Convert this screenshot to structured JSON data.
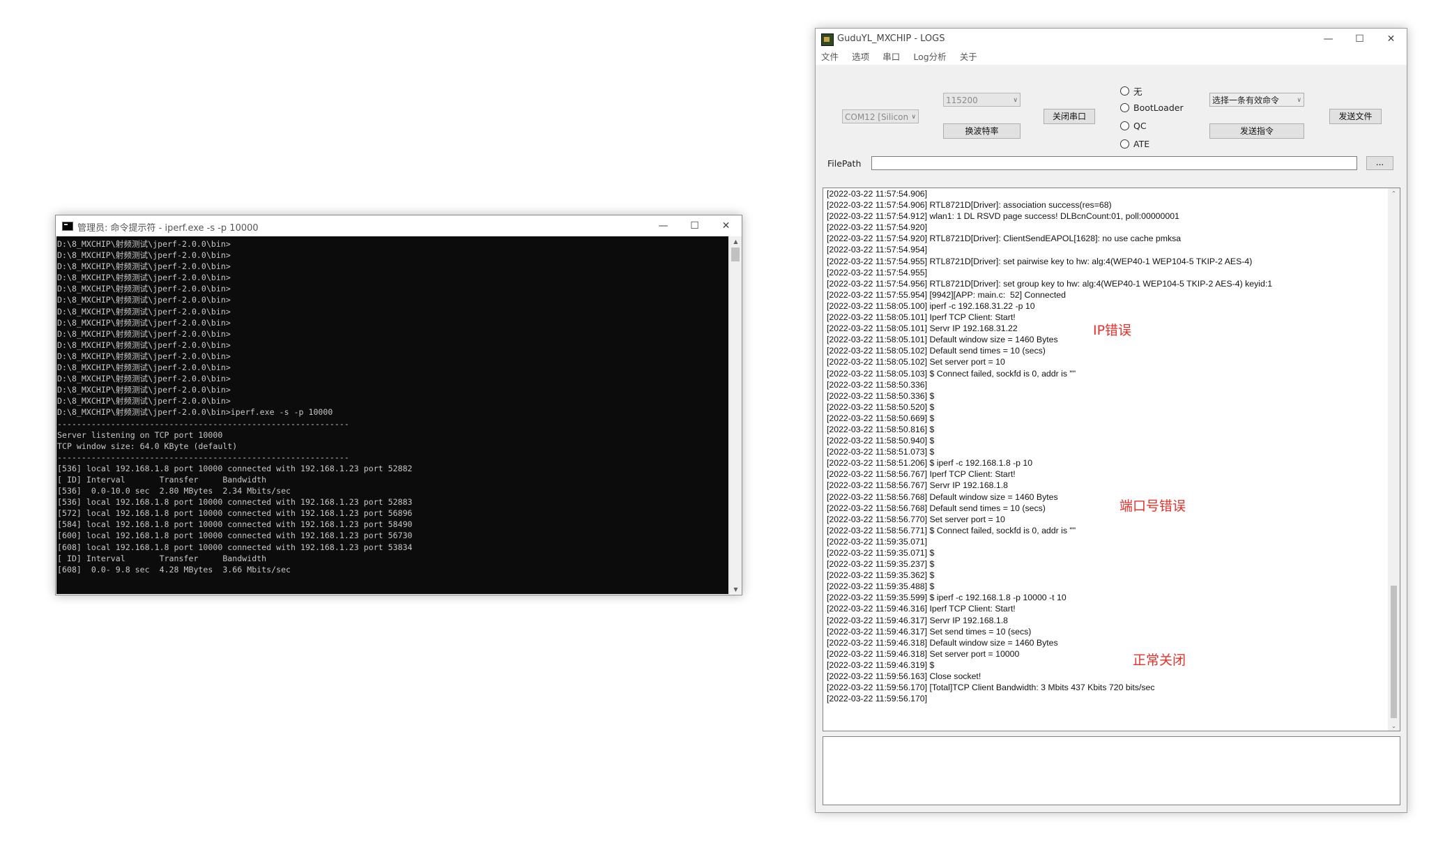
{
  "cmd_window": {
    "title": "管理员: 命令提示符 - iperf.exe  -s -p 10000",
    "console_lines": [
      "D:\\8_MXCHIP\\射频测试\\jperf-2.0.0\\bin>",
      "D:\\8_MXCHIP\\射频测试\\jperf-2.0.0\\bin>",
      "D:\\8_MXCHIP\\射频测试\\jperf-2.0.0\\bin>",
      "D:\\8_MXCHIP\\射频测试\\jperf-2.0.0\\bin>",
      "D:\\8_MXCHIP\\射频测试\\jperf-2.0.0\\bin>",
      "D:\\8_MXCHIP\\射频测试\\jperf-2.0.0\\bin>",
      "D:\\8_MXCHIP\\射频测试\\jperf-2.0.0\\bin>",
      "D:\\8_MXCHIP\\射频测试\\jperf-2.0.0\\bin>",
      "D:\\8_MXCHIP\\射频测试\\jperf-2.0.0\\bin>",
      "D:\\8_MXCHIP\\射频测试\\jperf-2.0.0\\bin>",
      "D:\\8_MXCHIP\\射频测试\\jperf-2.0.0\\bin>",
      "D:\\8_MXCHIP\\射频测试\\jperf-2.0.0\\bin>",
      "D:\\8_MXCHIP\\射频测试\\jperf-2.0.0\\bin>",
      "D:\\8_MXCHIP\\射频测试\\jperf-2.0.0\\bin>",
      "D:\\8_MXCHIP\\射频测试\\jperf-2.0.0\\bin>",
      "D:\\8_MXCHIP\\射频测试\\jperf-2.0.0\\bin>iperf.exe -s -p 10000",
      "------------------------------------------------------------",
      "Server listening on TCP port 10000",
      "TCP window size: 64.0 KByte (default)",
      "------------------------------------------------------------",
      "[536] local 192.168.1.8 port 10000 connected with 192.168.1.23 port 52882",
      "[ ID] Interval       Transfer     Bandwidth",
      "[536]  0.0-10.0 sec  2.80 MBytes  2.34 Mbits/sec",
      "[536] local 192.168.1.8 port 10000 connected with 192.168.1.23 port 52883",
      "[572] local 192.168.1.8 port 10000 connected with 192.168.1.23 port 56896",
      "[584] local 192.168.1.8 port 10000 connected with 192.168.1.23 port 58490",
      "[600] local 192.168.1.8 port 10000 connected with 192.168.1.23 port 56730",
      "[608] local 192.168.1.8 port 10000 connected with 192.168.1.23 port 53834",
      "[ ID] Interval       Transfer     Bandwidth",
      "[608]  0.0- 9.8 sec  4.28 MBytes  3.66 Mbits/sec"
    ]
  },
  "log_window": {
    "title": "GuduYL_MXCHIP - LOGS",
    "menu": [
      "文件",
      "选项",
      "串口",
      "Log分析",
      "关于"
    ],
    "port_select": "COM12 [Silicon",
    "baud_select": "115200",
    "change_baud_button": "换波特率",
    "close_port_button": "关闭串口",
    "radios": [
      "无",
      "BootLoader",
      "QC",
      "ATE"
    ],
    "command_select": "选择一条有效命令",
    "send_command_button": "发送指令",
    "send_file_button": "发送文件",
    "filepath_label": "FilePath",
    "filepath_value": "",
    "browse_button": "...",
    "log_lines": [
      "[2022-03-22 11:57:54.906]",
      "[2022-03-22 11:57:54.906] RTL8721D[Driver]: association success(res=68)",
      "[2022-03-22 11:57:54.912] wlan1: 1 DL RSVD page success! DLBcnCount:01, poll:00000001",
      "[2022-03-22 11:57:54.920]",
      "[2022-03-22 11:57:54.920] RTL8721D[Driver]: ClientSendEAPOL[1628]: no use cache pmksa",
      "[2022-03-22 11:57:54.954]",
      "[2022-03-22 11:57:54.955] RTL8721D[Driver]: set pairwise key to hw: alg:4(WEP40-1 WEP104-5 TKIP-2 AES-4)",
      "[2022-03-22 11:57:54.955]",
      "[2022-03-22 11:57:54.956] RTL8721D[Driver]: set group key to hw: alg:4(WEP40-1 WEP104-5 TKIP-2 AES-4) keyid:1",
      "[2022-03-22 11:57:55.954] [9942][APP: main.c:  52] Connected",
      "[2022-03-22 11:58:05.100] iperf -c 192.168.31.22 -p 10",
      "[2022-03-22 11:58:05.101] Iperf TCP Client: Start!",
      "[2022-03-22 11:58:05.101] Servr IP 192.168.31.22",
      "[2022-03-22 11:58:05.101] Default window size = 1460 Bytes",
      "[2022-03-22 11:58:05.102] Default send times = 10 (secs)",
      "[2022-03-22 11:58:05.102] Set server port = 10",
      "[2022-03-22 11:58:05.103] $ Connect failed, sockfd is 0, addr is \"\"",
      "[2022-03-22 11:58:50.336]",
      "[2022-03-22 11:58:50.336] $",
      "[2022-03-22 11:58:50.520] $",
      "[2022-03-22 11:58:50.669] $",
      "[2022-03-22 11:58:50.816] $",
      "[2022-03-22 11:58:50.940] $",
      "[2022-03-22 11:58:51.073] $",
      "[2022-03-22 11:58:51.206] $ iperf -c 192.168.1.8 -p 10",
      "[2022-03-22 11:58:56.767] Iperf TCP Client: Start!",
      "[2022-03-22 11:58:56.767] Servr IP 192.168.1.8",
      "[2022-03-22 11:58:56.768] Default window size = 1460 Bytes",
      "[2022-03-22 11:58:56.768] Default send times = 10 (secs)",
      "[2022-03-22 11:58:56.770] Set server port = 10",
      "[2022-03-22 11:58:56.771] $ Connect failed, sockfd is 0, addr is \"\"",
      "[2022-03-22 11:59:35.071]",
      "[2022-03-22 11:59:35.071] $",
      "[2022-03-22 11:59:35.237] $",
      "[2022-03-22 11:59:35.362] $",
      "[2022-03-22 11:59:35.488] $",
      "[2022-03-22 11:59:35.599] $ iperf -c 192.168.1.8 -p 10000 -t 10",
      "[2022-03-22 11:59:46.316] Iperf TCP Client: Start!",
      "[2022-03-22 11:59:46.317] Servr IP 192.168.1.8",
      "[2022-03-22 11:59:46.317] Set send times = 10 (secs)",
      "[2022-03-22 11:59:46.318] Default window size = 1460 Bytes",
      "[2022-03-22 11:59:46.318] Set server port = 10000",
      "[2022-03-22 11:59:46.319] $",
      "[2022-03-22 11:59:56.163] Close socket!",
      "[2022-03-22 11:59:56.170] [Total]TCP Client Bandwidth: 3 Mbits 437 Kbits 720 bits/sec",
      "[2022-03-22 11:59:56.170]"
    ],
    "annotations": {
      "ip_error": "IP错误",
      "port_error": "端口号错误",
      "normal_close": "正常关闭"
    },
    "annotation_color": "#e8302a"
  }
}
